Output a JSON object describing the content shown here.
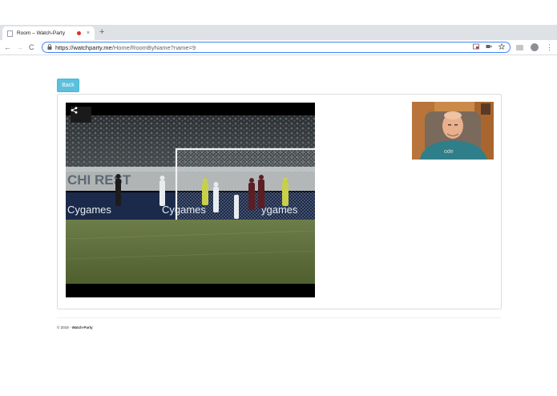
{
  "browser": {
    "tab_title": "Room – Watch-Party",
    "tab_close": "×",
    "new_tab": "+",
    "back": "←",
    "forward": "→",
    "reload": "C",
    "url_host": "https://watchparty.me",
    "url_path": "/Home/RoomByName?name=9"
  },
  "page": {
    "back_label": "Back",
    "footer_year": "© 2018 - ",
    "footer_brand": "Watch-Party"
  },
  "video": {
    "ad_board_1": "Cygames",
    "ad_board_2": "Cygames",
    "ad_board_3": "ygames",
    "banner_text": "CHI REST"
  },
  "colors": {
    "back_button": "#5bc0de",
    "pitch": "#5c6e3a",
    "webcam_shirt": "#2f7f8a"
  },
  "icons": {
    "share": "share-icon",
    "lock": "lock-icon",
    "star": "star-icon"
  }
}
